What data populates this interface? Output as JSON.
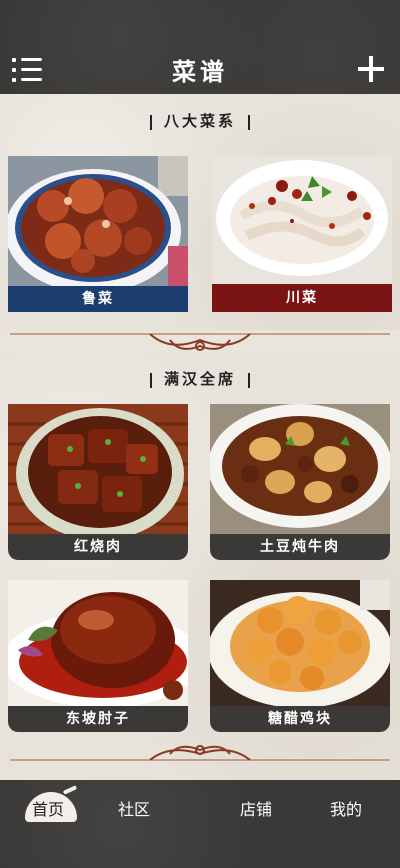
{
  "header": {
    "title": "菜谱",
    "menu_icon": "menu-icon",
    "add_icon": "plus-icon"
  },
  "sections": [
    {
      "title": "八大菜系",
      "cards": [
        {
          "label": "鲁菜",
          "label_color": "#1c3e6e",
          "icon": "braised-pork-dish"
        },
        {
          "label": "川菜",
          "label_color": "#7a1414",
          "icon": "sichuan-noodle-dish"
        }
      ]
    },
    {
      "title": "满汉全席",
      "cards": [
        {
          "label": "红烧肉",
          "label_color": "#3b3937",
          "icon": "red-braised-pork-dish"
        },
        {
          "label": "土豆炖牛肉",
          "label_color": "#3b3937",
          "icon": "potato-beef-stew-dish"
        },
        {
          "label": "东坡肘子",
          "label_color": "#3b3937",
          "icon": "dongpo-pork-knuckle-dish"
        },
        {
          "label": "糖醋鸡块",
          "label_color": "#3b3937",
          "icon": "sweet-sour-chicken-dish"
        }
      ]
    }
  ],
  "tabs": [
    {
      "label": "首页",
      "active": true
    },
    {
      "label": "社区",
      "active": false
    },
    {
      "label": "店铺",
      "active": false
    },
    {
      "label": "我的",
      "active": false
    }
  ]
}
